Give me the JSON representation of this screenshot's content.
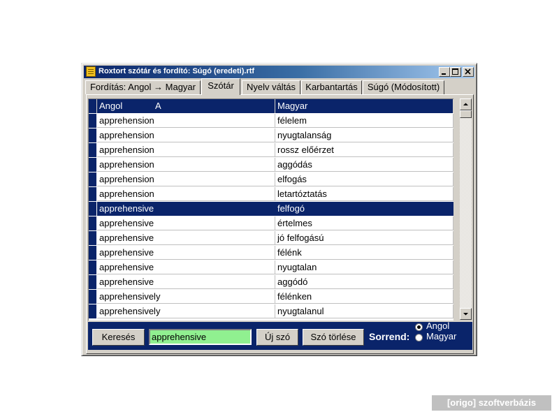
{
  "window": {
    "title": "Roxtort szótár és fordító: Súgó (eredeti).rtf"
  },
  "tabs": [
    {
      "label": "Fordítás: Angol → Magyar"
    },
    {
      "label": "Szótár",
      "active": true
    },
    {
      "label": "Nyelv váltás"
    },
    {
      "label": "Karbantartás"
    },
    {
      "label": "Súgó (Módosított)"
    }
  ],
  "grid": {
    "columns": [
      {
        "label": "Angol",
        "sort_marker": "A"
      },
      {
        "label": "Magyar"
      }
    ],
    "rows": [
      {
        "angol": "apprehension",
        "magyar": "félelem"
      },
      {
        "angol": "apprehension",
        "magyar": "nyugtalanság"
      },
      {
        "angol": "apprehension",
        "magyar": "rossz előérzet"
      },
      {
        "angol": "apprehension",
        "magyar": "aggódás"
      },
      {
        "angol": "apprehension",
        "magyar": "elfogás"
      },
      {
        "angol": "apprehension",
        "magyar": "letartóztatás"
      },
      {
        "angol": "apprehensive",
        "magyar": "felfogó",
        "selected": true
      },
      {
        "angol": "apprehensive",
        "magyar": "értelmes"
      },
      {
        "angol": "apprehensive",
        "magyar": "jó felfogású"
      },
      {
        "angol": "apprehensive",
        "magyar": "félénk"
      },
      {
        "angol": "apprehensive",
        "magyar": "nyugtalan"
      },
      {
        "angol": "apprehensive",
        "magyar": "aggódó"
      },
      {
        "angol": "apprehensively",
        "magyar": "félénken"
      },
      {
        "angol": "apprehensively",
        "magyar": "nyugtalanul"
      }
    ]
  },
  "bottom_bar": {
    "search_button": "Keresés",
    "search_value": "apprehensive",
    "new_word_button": "Új szó",
    "delete_word_button": "Szó törlése",
    "sort_label": "Sorrend:",
    "sort_options": [
      {
        "label": "Angol",
        "checked": true
      },
      {
        "label": "Magyar",
        "checked": false
      }
    ]
  },
  "watermark": "[origo] szoftverbázis",
  "colors": {
    "selection": "#0a246a",
    "search_bg": "#90f090",
    "face": "#d4d0c8"
  }
}
